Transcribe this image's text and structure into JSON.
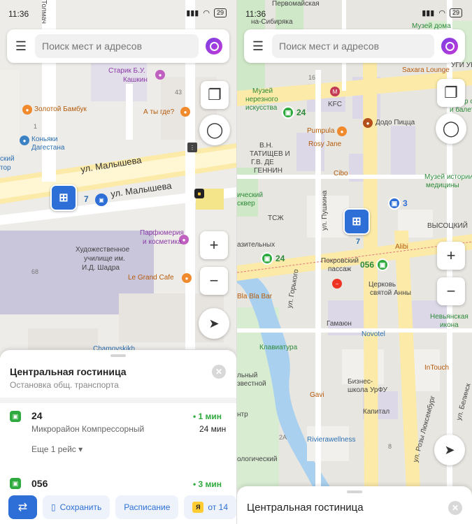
{
  "status_left": {
    "time": "11:36",
    "battery": "29"
  },
  "status_right": {
    "time": "11:36",
    "battery": "29"
  },
  "search": {
    "placeholder": "Поиск мест и адресов"
  },
  "left_map": {
    "street_label_1": "ул. Малышева",
    "street_label_2": "ул. Малышева",
    "street_top": "Толмач",
    "labels": {
      "starik": "Старик Б.У.",
      "kashkin": "Кашкин",
      "zolotoy": "Золотой Бамбук",
      "a_ty_gde": "А ты где?",
      "konyaki": "Коньяки",
      "dagestana": "Дагестана",
      "skiy": "ский",
      "tor": "тор",
      "parfum1": "Парфюмерия",
      "parfum2": "и косметика",
      "uchil1": "Художественное",
      "uchil2": "училище им.",
      "uchil3": "И.Д. Шадра",
      "legrand": "Le Grand Cafe",
      "chamov": "Chamovskikh",
      "num43": "43",
      "num1": "1",
      "num68": "68"
    },
    "bus_route_num": "7"
  },
  "sheet_left": {
    "title": "Центральная гостиница",
    "subtitle": "Остановка общ. транспорта",
    "routes": [
      {
        "number": "24",
        "destination": "Микрорайон Компрессорный",
        "eta_first": "• 1 мин",
        "eta_second": "24 мин",
        "more": "Еще 1 рейс ▾"
      },
      {
        "number": "056",
        "eta_first": "• 3 мин"
      }
    ],
    "actions": {
      "save": "Сохранить",
      "schedule": "Расписание",
      "taxi": "от 14"
    }
  },
  "right_map": {
    "labels": {
      "pervomay": "Первомайская",
      "sibiryaka": "на-Сибиряка",
      "muzey_doma": "Музей дома",
      "saxara": "Saxara Lounge",
      "ugi_uny": "УГИ УНЫ",
      "muzey_izo1": "Музей",
      "muzey_izo2": "нерезного",
      "muzey_izo3": "искусства",
      "kfc": "KFC",
      "teatr1": "Театр оперы",
      "teatr2": "и балета",
      "dodo": "Додо Пицца",
      "pumpula": "Pumpula",
      "rosy": "Rosy Jane",
      "tatishev1": "В.Н.",
      "tatishev2": "ТАТИЩЕВ И",
      "tatishev3": "Г.В. ДЕ",
      "tatishev4": "ГЕННИН",
      "cibo": "Cibo",
      "muzey_med1": "Музей истории",
      "muzey_med2": "медицины",
      "sky1": "ический",
      "sky2": "сквер",
      "tszh": "ТСЖ",
      "pushkina": "ул. Пушкина",
      "vysotsky": "ВЫСОЦКИЙ",
      "alibi": "Alibi",
      "pokrov1": "Покровский",
      "pokrov2": "пассаж",
      "gorkogo": "ул. Горького",
      "tserkov1": "Церковь",
      "tserkov2": "святой Анны",
      "blabla": "Bla Bla Bar",
      "nevyan1": "Невьянская",
      "nevyan2": "икона",
      "gamaun": "Гамаюн",
      "novotel": "Novotel",
      "klaviatura": "Клавиатура",
      "intouch": "InTouch",
      "biz1": "Бизнес-",
      "biz2": "школа УрФУ",
      "gavi": "Gavi",
      "kapital": "Капитал",
      "riviera": "Rivierawellness",
      "rozy": "ул. Розы Люксембург",
      "belinsk": "ул. Белинск",
      "ogich": "ологический",
      "zvest": "звестной",
      "ntr": "нтр",
      "lnyy": "льный",
      "zit": "азительных",
      "num16": "16",
      "num2a": "2А",
      "num8": "8"
    },
    "bus_route_1": "24",
    "bus_route_2": "24",
    "bus_route_3": "056",
    "bus_route_4": "7",
    "bus_route_5": "3"
  },
  "sheet_right": {
    "title": "Центральная гостиница"
  }
}
